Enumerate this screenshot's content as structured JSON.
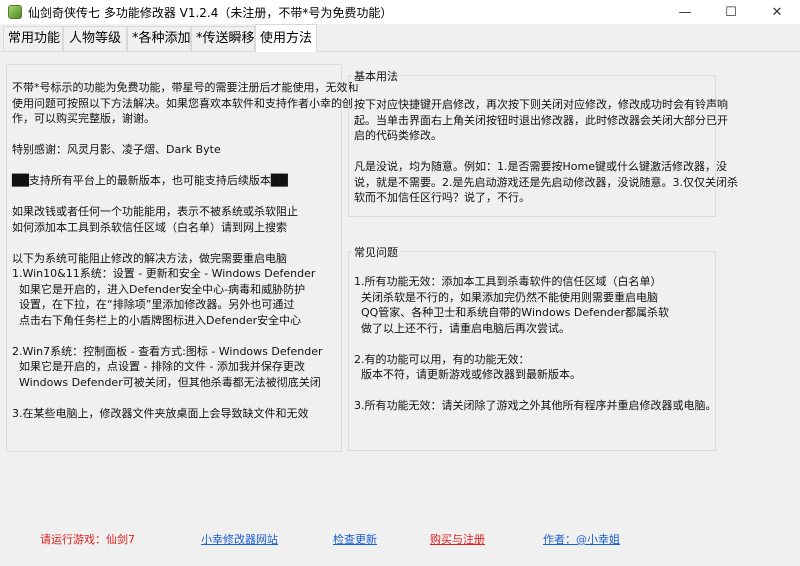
{
  "window": {
    "title": "仙剑奇侠传七 多功能修改器  V1.2.4（未注册，不带*号为免费功能）",
    "minimize": "—",
    "maximize": "☐",
    "close": "✕"
  },
  "tabs": [
    {
      "label": "常用功能",
      "active": false
    },
    {
      "label": "人物等级",
      "active": false
    },
    {
      "label": "*各种添加",
      "active": false
    },
    {
      "label": "*传送瞬移",
      "active": false
    },
    {
      "label": "使用方法",
      "active": true
    }
  ],
  "left_panel": {
    "text": "不带*号标示的功能为免费功能，带星号的需要注册后才能使用，无效和\n使用问题可按照以下方法解决。如果您喜欢本软件和支持作者小幸的创\n作，可以购买完整版，谢谢。\n\n特别感谢：风灵月影、凌子熠、Dark Byte\n\n██支持所有平台上的最新版本，也可能支持后续版本██\n\n如果改钱或者任何一个功能能用，表示不被系统或杀软阻止\n如何添加本工具到杀软信任区域（白名单）请到网上搜索\n\n以下为系统可能阻止修改的解决方法，做完需要重启电脑\n1.Win10&11系统：设置 - 更新和安全 - Windows Defender\n  如果它是开启的，进入Defender安全中心-病毒和威胁防护\n  设置，在下拉，在“排除项”里添加修改器。另外也可通过\n  点击右下角任务栏上的小盾牌图标进入Defender安全中心\n\n2.Win7系统：控制面板 - 查看方式:图标 - Windows Defender\n  如果它是开启的，点设置 - 排除的文件 - 添加我并保存更改\n  Windows Defender可被关闭，但其他杀毒都无法被彻底关闭\n\n3.在某些电脑上，修改器文件夹放桌面上会导致缺文件和无效"
  },
  "basic_usage": {
    "title": "基本用法",
    "text": "按下对应快捷键开启修改，再次按下则关闭对应修改，修改成功时会有铃声响\n起。当单击界面右上角关闭按钮时退出修改器，此时修改器会关闭大部分已开\n启的代码类修改。\n\n凡是没说，均为随意。例如：1.是否需要按Home键或什么键激活修改器，没\n说，就是不需要。2.是先启动游戏还是先启动修改器，没说随意。3.仅仅关闭杀\n软而不加信任区行吗？说了，不行。"
  },
  "faq": {
    "title": "常见问题",
    "text": "1.所有功能无效：添加本工具到杀毒软件的信任区域（白名单）\n  关闭杀软是不行的，如果添加完仍然不能使用则需要重启电脑\n  QQ管家、各种卫士和系统自带的Windows Defender都属杀软\n  做了以上还不行，请重启电脑后再次尝试。\n\n2.有的功能可以用，有的功能无效：\n  版本不符，请更新游戏或修改器到最新版本。\n\n3.所有功能无效：请关闭除了游戏之外其他所有程序并重启修改器或电脑。"
  },
  "footer": {
    "game": "请运行游戏：仙剑7",
    "site": "小幸修改器网站",
    "update": "检查更新",
    "buy": "购买与注册",
    "author": "作者：@小幸姐"
  },
  "colors": {
    "red": "#e02020",
    "blue": "#1a5fd0",
    "border": "#dcdcdc",
    "background": "#f0f0f0"
  }
}
